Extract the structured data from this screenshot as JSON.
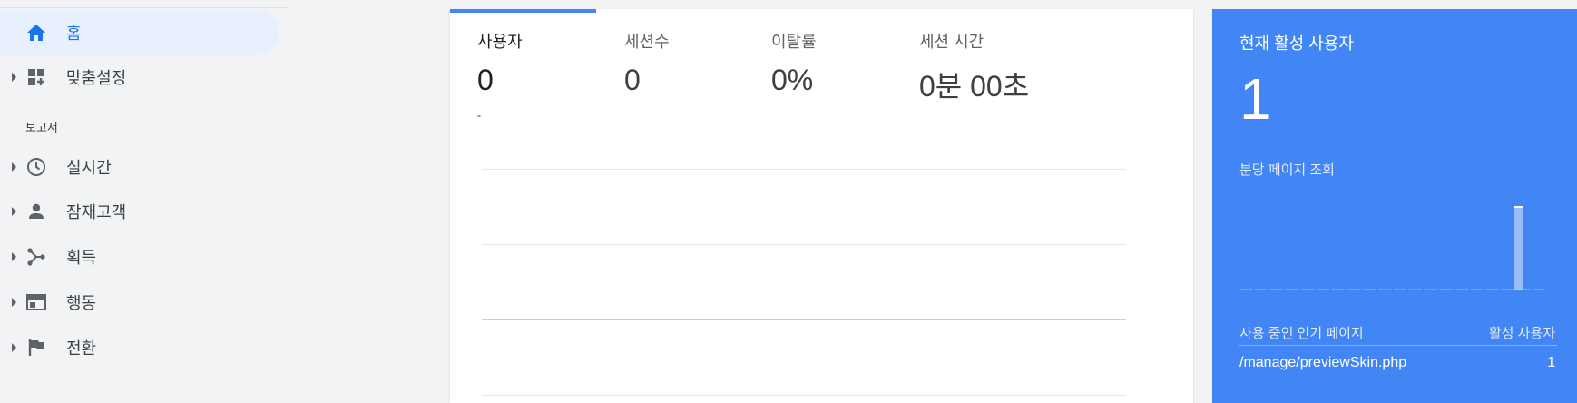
{
  "sidebar": {
    "items": [
      {
        "label": "홈",
        "icon": "home-icon"
      },
      {
        "label": "맞춤설정",
        "icon": "dashboard-add-icon"
      }
    ],
    "section_label": "보고서",
    "report_items": [
      {
        "label": "실시간",
        "icon": "clock-icon"
      },
      {
        "label": "잠재고객",
        "icon": "person-icon"
      },
      {
        "label": "획득",
        "icon": "acquisition-icon"
      },
      {
        "label": "행동",
        "icon": "behavior-icon"
      },
      {
        "label": "전환",
        "icon": "flag-icon"
      }
    ]
  },
  "overview": {
    "metrics": [
      {
        "label": "사용자",
        "value": "0"
      },
      {
        "label": "세션수",
        "value": "0"
      },
      {
        "label": "이탈률",
        "value": "0%"
      },
      {
        "label": "세션 시간",
        "value": "0분 00초"
      }
    ],
    "users_change": "-"
  },
  "realtime": {
    "title": "현재 활성 사용자",
    "active_users": "1",
    "pageviews_per_minute_label": "분당 페이지 조회",
    "top_pages_header": "사용 중인 인기 페이지",
    "active_users_header": "활성 사용자",
    "top_pages": [
      {
        "page": "/manage/previewSkin.php",
        "users": "1"
      }
    ]
  },
  "colors": {
    "accent": "#1a73e8",
    "realtime_bg": "#4285f4",
    "sidebar_bg": "#f1f3f4"
  }
}
